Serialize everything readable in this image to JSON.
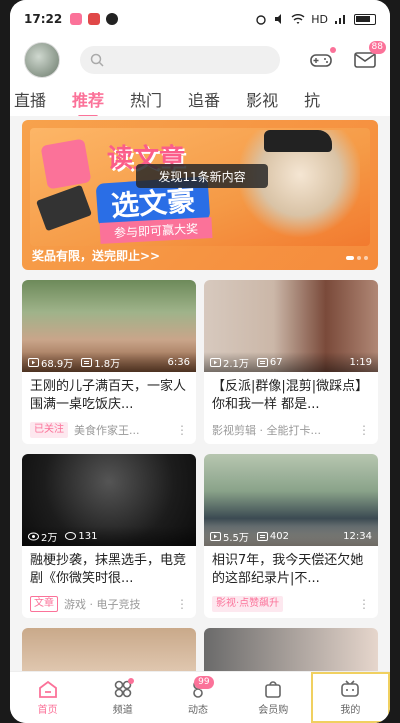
{
  "status_bar": {
    "time": "17:22",
    "network": "HD",
    "battery_icon": "battery-icon"
  },
  "tabs": [
    "直播",
    "推荐",
    "热门",
    "追番",
    "影视",
    "抗"
  ],
  "active_tab": "推荐",
  "header": {
    "message_badge": "88"
  },
  "banner": {
    "text_line1": "读文章",
    "text_line2": "选文豪",
    "text_line3": "参与即可赢大奖",
    "caption": "奖品有限，送完即止>>",
    "toast": "发现11条新内容"
  },
  "cards": [
    {
      "views": "68.9万",
      "comments": "1.8万",
      "duration": "6:36",
      "title": "王刚的儿子满百天，一家人围满一桌吃饭庆...",
      "tag": "已关注",
      "author": "美食作家王..."
    },
    {
      "views": "2.1万",
      "comments": "67",
      "duration": "1:19",
      "title": "【反派|群像|混剪|微踩点】你和我一样 都是...",
      "tag": "",
      "author": "影视剪辑 · 全能打卡..."
    },
    {
      "views": "2万",
      "comments": "131",
      "duration": "",
      "title": "融梗抄袭，抹黑选手，电竞剧《你微笑时很...",
      "tag": "文章",
      "author": "游戏 · 电子竞技"
    },
    {
      "views": "5.5万",
      "comments": "402",
      "duration": "12:34",
      "title": "相识7年，我今天偿还欠她的这部纪录片|不...",
      "tag": "影视·点赞飙升",
      "author": ""
    }
  ],
  "bottom_nav": [
    {
      "label": "首页",
      "icon": "home-icon"
    },
    {
      "label": "频道",
      "icon": "channel-icon"
    },
    {
      "label": "动态",
      "icon": "dynamic-icon",
      "badge": "99"
    },
    {
      "label": "会员购",
      "icon": "shop-icon"
    },
    {
      "label": "我的",
      "icon": "profile-icon"
    }
  ],
  "colors": {
    "accent": "#fb7299"
  }
}
